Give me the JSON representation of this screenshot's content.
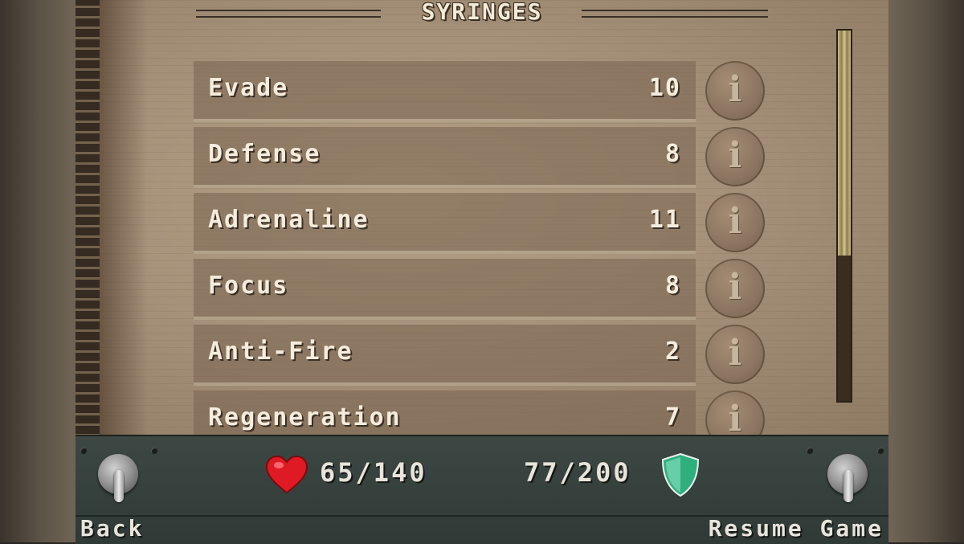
{
  "header": {
    "title": "SYRINGES"
  },
  "syringes": [
    {
      "name": "Evade",
      "count": "10"
    },
    {
      "name": "Defense",
      "count": "8"
    },
    {
      "name": "Adrenaline",
      "count": "11"
    },
    {
      "name": "Focus",
      "count": "8"
    },
    {
      "name": "Anti-Fire",
      "count": "2"
    },
    {
      "name": "Regeneration",
      "count": "7"
    }
  ],
  "info_glyph": "i",
  "status": {
    "health": "65/140",
    "armor": "77/200",
    "health_icon": "heart-icon",
    "armor_icon": "shield-icon",
    "health_color": "#e01a24",
    "armor_color": "#2fae7e"
  },
  "buttons": {
    "back_label": "Back",
    "resume_label": "Resume Game"
  },
  "scroll": {
    "position": 0.0,
    "visible_fraction": 0.6
  }
}
